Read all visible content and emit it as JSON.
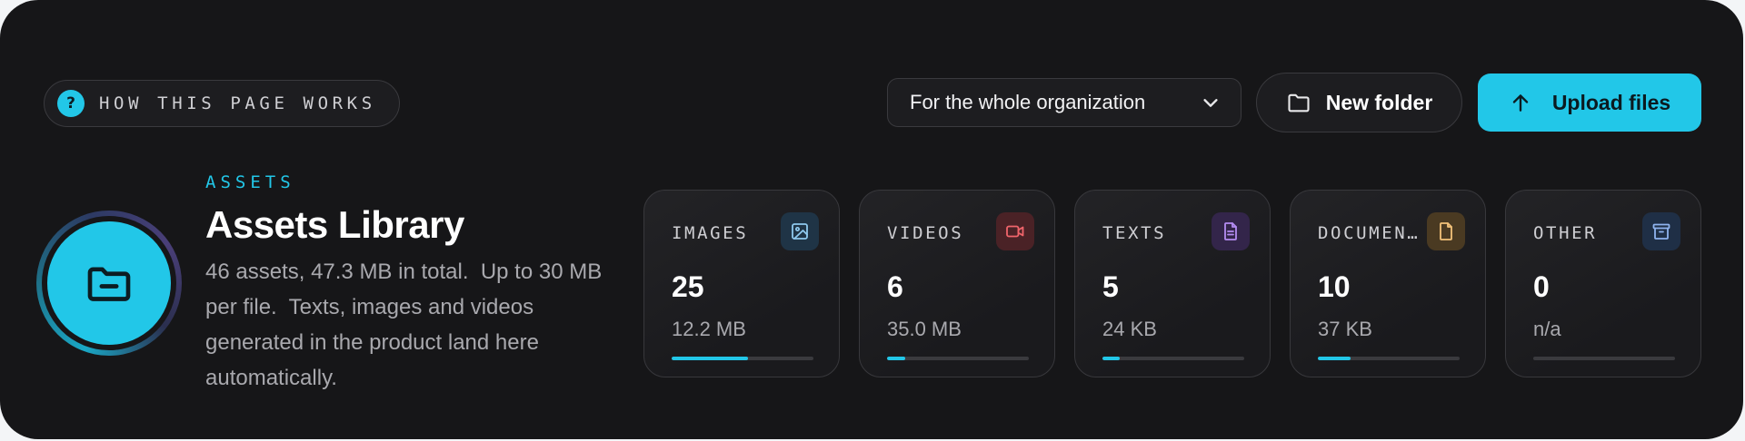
{
  "help": {
    "label": "HOW THIS PAGE WORKS",
    "icon": "question-icon"
  },
  "scope": {
    "selected": "For the whole organization",
    "icon": "chevron-down-icon"
  },
  "actions": {
    "new_folder": {
      "label": "New folder",
      "icon": "folder-icon"
    },
    "upload": {
      "label": "Upload files",
      "icon": "arrow-up-icon"
    }
  },
  "hero": {
    "icon": "folder-minus-icon",
    "eyebrow": "ASSETS",
    "title": "Assets Library",
    "description": "46 assets, 47.3 MB in total.  Up to 30 MB per file.  Texts, images and videos generated in the product land here automatically."
  },
  "colors": {
    "accent": "#22c7e8",
    "panel": "#161618"
  },
  "stats": [
    {
      "key": "images",
      "label": "IMAGES",
      "count": "25",
      "size": "12.2 MB",
      "share": 0.54,
      "icon": "image-icon",
      "badge_bg": "#1f3446",
      "icon_color": "#8fc9ee"
    },
    {
      "key": "videos",
      "label": "VIDEOS",
      "count": "6",
      "size": "35.0 MB",
      "share": 0.13,
      "icon": "video-icon",
      "badge_bg": "#4a2226",
      "icon_color": "#f0656b"
    },
    {
      "key": "texts",
      "label": "TEXTS",
      "count": "5",
      "size": "24 KB",
      "share": 0.12,
      "icon": "text-file-icon",
      "badge_bg": "#33254a",
      "icon_color": "#b48cf2"
    },
    {
      "key": "documents",
      "label": "DOCUMENTS",
      "count": "10",
      "size": "37 KB",
      "share": 0.23,
      "icon": "document-icon",
      "badge_bg": "#4a3a22",
      "icon_color": "#f2c27a"
    },
    {
      "key": "other",
      "label": "OTHER",
      "count": "0",
      "size": "n/a",
      "share": 0,
      "icon": "archive-icon",
      "badge_bg": "#1f2f46",
      "icon_color": "#8fb3ee"
    }
  ]
}
